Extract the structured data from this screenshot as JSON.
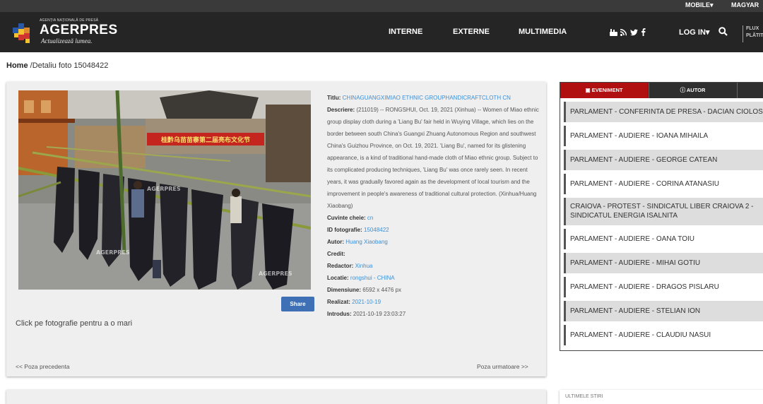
{
  "topbar": {
    "mobile": "MOBILE",
    "language": "MAGYAR"
  },
  "header": {
    "logo_small": "AGENȚIA NAȚIONALĂ DE PRESĂ",
    "logo_name": "AGERPRES",
    "logo_tagline": "Actualizează lumea.",
    "menu": [
      "INTERNE",
      "EXTERNE",
      "MULTIMEDIA"
    ],
    "social_icons": [
      "youtube-icon",
      "rss-icon",
      "twitter-icon",
      "facebook-icon"
    ],
    "login": "LOG IN",
    "flux_line1": "FLUX",
    "flux_line2": "PLĂTIT"
  },
  "breadcrumb": {
    "home": "Home",
    "current": "Detaliu foto 15048422"
  },
  "photo": {
    "watermark": "AGERPRES",
    "sign_text": "桂黔乌苗苗寨第二届亮布文化节",
    "share_label": "Share",
    "click_hint": "Click pe fotografie pentru a o mari"
  },
  "meta": {
    "title_label": "Titlu:",
    "title_value": "CHINAGUANGXIMIAO ETHNIC GROUPHANDICRAFTCLOTH CN",
    "desc_label": "Descriere:",
    "desc_value": "(211019) -- RONGSHUI, Oct. 19, 2021 (Xinhua) -- Women of Miao ethnic group display cloth during a 'Liang Bu' fair held in Wuying Village, which lies on the border between south China's Guangxi Zhuang Autonomous Region and southwest China's Guizhou Province, on Oct. 19, 2021. 'Liang Bu', named for its glistening appearance, is a kind of traditional hand-made cloth of Miao ethnic group. Subject to its complicated producing techniques, 'Liang Bu' was once rarely seen. In recent years, it was gradually favored again as the development of local tourism and the improvement in people's awareness of traditional cultural protection. (Xinhua/Huang Xiaobang)",
    "keywords_label": "Cuvinte cheie:",
    "keywords_value": "cn",
    "id_label": "ID fotografie:",
    "id_value": "15048422",
    "author_label": "Autor:",
    "author_value": "Huang Xiaobang",
    "credit_label": "Credit:",
    "credit_value": "",
    "editor_label": "Redactor:",
    "editor_value": "Xinhua",
    "location_label": "Locatie:",
    "location_city": "rongshui",
    "location_sep": " - ",
    "location_country": "CHINA",
    "size_label": "Dimensiune:",
    "size_value": "6592 x 4476 px",
    "made_label": "Realizat:",
    "made_value": "2021-10-19",
    "added_label": "Introdus:",
    "added_value": "2021-10-19 23:03:27"
  },
  "pager": {
    "prev": "<< Poza precedenta",
    "next": "Poza urmatoare >>"
  },
  "sidebar": {
    "tabs": [
      {
        "label": "EVENIMENT",
        "icon": "image-icon"
      },
      {
        "label": "AUTOR",
        "icon": "info-icon"
      }
    ],
    "items": [
      "PARLAMENT - CONFERINTA DE PRESA - DACIAN CIOLOS",
      "PARLAMENT - AUDIERE - IOANA MIHAILA",
      "PARLAMENT - AUDIERE - GEORGE CATEAN",
      "PARLAMENT - AUDIERE - CORINA ATANASIU",
      "CRAIOVA - PROTEST - SINDICATUL LIBER CRAIOVA 2 - SINDICATUL ENERGIA ISALNITA",
      "PARLAMENT - AUDIERE - OANA TOIU",
      "PARLAMENT - AUDIERE - MIHAI GOTIU",
      "PARLAMENT - AUDIERE - DRAGOS PISLARU",
      "PARLAMENT - AUDIERE - STELIAN ION",
      "PARLAMENT - AUDIERE - CLAUDIU NASUI"
    ],
    "next_section_hint": "ULTIMELE STIRI"
  }
}
